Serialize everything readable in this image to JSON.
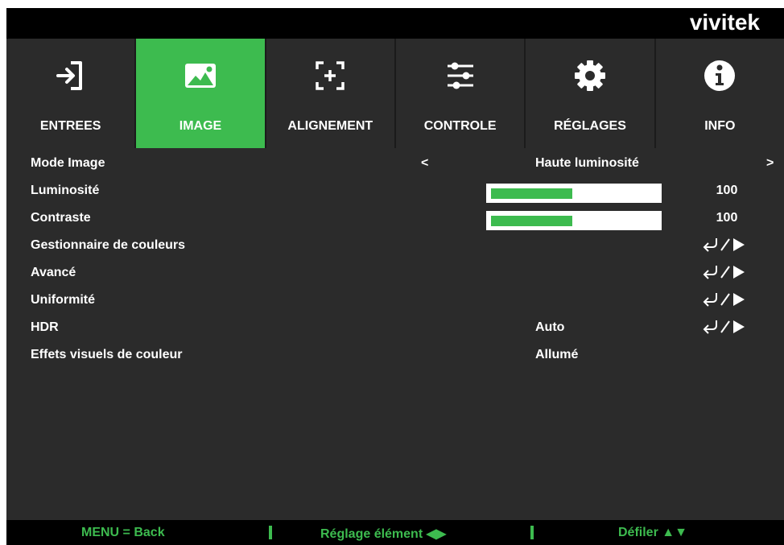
{
  "brand": "vivitek",
  "tabs": [
    {
      "label": "ENTREES",
      "icon": "input-icon",
      "active": false
    },
    {
      "label": "IMAGE",
      "icon": "image-icon",
      "active": true
    },
    {
      "label": "ALIGNEMENT",
      "icon": "alignment-icon",
      "active": false
    },
    {
      "label": "CONTROLE",
      "icon": "sliders-icon",
      "active": false
    },
    {
      "label": "RÉGLAGES",
      "icon": "gear-icon",
      "active": false
    },
    {
      "label": "INFO",
      "icon": "info-icon",
      "active": false
    }
  ],
  "menu": {
    "mode_image": {
      "label": "Mode Image",
      "left_arrow": "<",
      "value": "Haute luminosité",
      "right_arrow": ">"
    },
    "luminosite": {
      "label": "Luminosité",
      "value": "100",
      "level_fraction": 0.49
    },
    "contraste": {
      "label": "Contraste",
      "value": "100",
      "level_fraction": 0.49
    },
    "gestionnaire": {
      "label": "Gestionnaire de couleurs"
    },
    "avance": {
      "label": "Avancé"
    },
    "uniformite": {
      "label": "Uniformité"
    },
    "hdr": {
      "label": "HDR",
      "value": "Auto"
    },
    "effets": {
      "label": "Effets visuels de couleur",
      "value": "Allumé"
    }
  },
  "footer": {
    "back": "MENU = Back",
    "adjust": "Réglage élément ◀▶",
    "scroll": "Défiler ▲▼"
  },
  "colors": {
    "accent": "#3dbb4f",
    "panel": "#2b2b2b",
    "topbar": "#000000"
  }
}
